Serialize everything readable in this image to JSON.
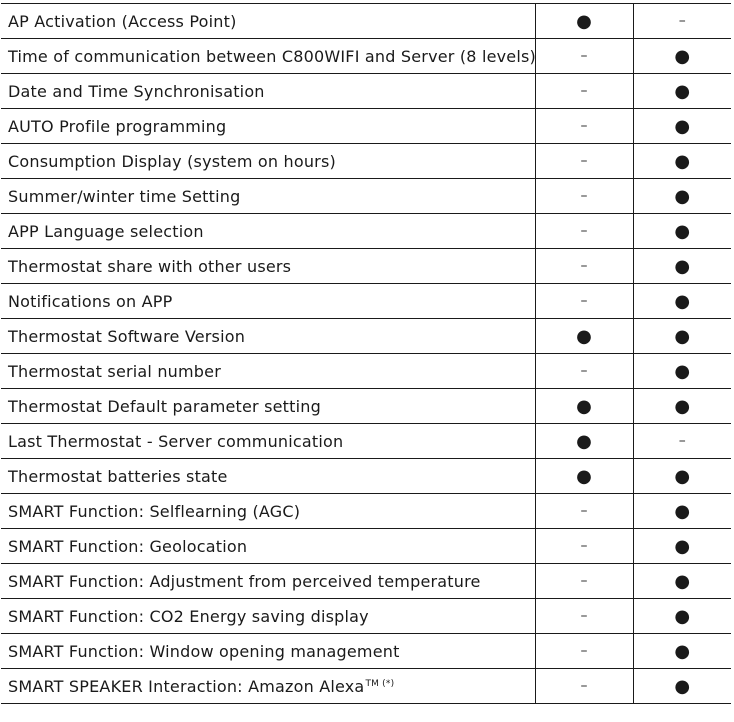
{
  "table": {
    "rows": [
      {
        "feature": "AP Activation (Access Point)",
        "col1": "●",
        "col2": "–"
      },
      {
        "feature": "Time of communication between C800WIFI and Server (8 levels)",
        "col1": "–",
        "col2": "●"
      },
      {
        "feature": "Date and Time Synchronisation",
        "col1": "–",
        "col2": "●"
      },
      {
        "feature": "AUTO Profile programming",
        "col1": "–",
        "col2": "●"
      },
      {
        "feature": "Consumption Display (system on hours)",
        "col1": "–",
        "col2": "●"
      },
      {
        "feature": "Summer/winter time Setting",
        "col1": "–",
        "col2": "●"
      },
      {
        "feature": "APP Language selection",
        "col1": "–",
        "col2": "●"
      },
      {
        "feature": "Thermostat share with other users",
        "col1": "–",
        "col2": "●"
      },
      {
        "feature": "Notifications on APP",
        "col1": "–",
        "col2": "●"
      },
      {
        "feature": "Thermostat Software Version",
        "col1": "●",
        "col2": "●"
      },
      {
        "feature": "Thermostat serial number",
        "col1": "–",
        "col2": "●"
      },
      {
        "feature": "Thermostat Default parameter setting",
        "col1": "●",
        "col2": "●"
      },
      {
        "feature": "Last Thermostat - Server communication",
        "col1": "●",
        "col2": "–"
      },
      {
        "feature": "Thermostat batteries state",
        "col1": "●",
        "col2": "●"
      },
      {
        "feature": "SMART Function: Selflearning (AGC)",
        "col1": "–",
        "col2": "●"
      },
      {
        "feature": "SMART Function: Geolocation",
        "col1": "–",
        "col2": "●"
      },
      {
        "feature": "SMART Function: Adjustment from perceived temperature",
        "col1": "–",
        "col2": "●"
      },
      {
        "feature": "SMART Function: CO2 Energy saving display",
        "col1": "–",
        "col2": "●"
      },
      {
        "feature": "SMART Function: Window opening management",
        "col1": "–",
        "col2": "●"
      },
      {
        "feature": "SMART SPEAKER Interaction:  Amazon Alexa",
        "feature_suffix": "TM (*)",
        "col1": "–",
        "col2": "●"
      }
    ]
  }
}
